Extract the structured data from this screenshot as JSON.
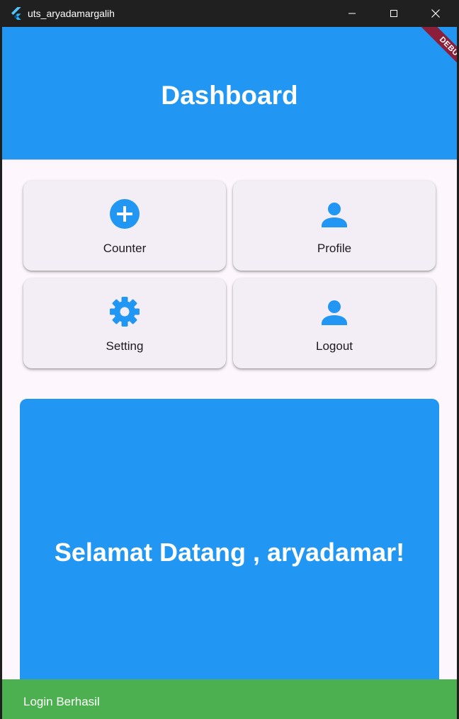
{
  "window": {
    "title": "uts_aryadamargalih",
    "controls": {
      "minimize_icon": "minimize-icon",
      "maximize_icon": "maximize-icon",
      "close_icon": "close-icon"
    }
  },
  "debug_banner": "DEBUG",
  "appbar": {
    "title": "Dashboard",
    "color": "#2196f3"
  },
  "menu": {
    "items": [
      {
        "label": "Counter",
        "icon": "add-circle-icon"
      },
      {
        "label": "Profile",
        "icon": "person-icon"
      },
      {
        "label": "Setting",
        "icon": "settings-gear-icon"
      },
      {
        "label": "Logout",
        "icon": "person-icon"
      }
    ],
    "icon_color": "#2196f3"
  },
  "welcome": {
    "text": "Selamat Datang , aryadamar!"
  },
  "snackbar": {
    "message": "Login Berhasil",
    "color": "#4caf50"
  }
}
